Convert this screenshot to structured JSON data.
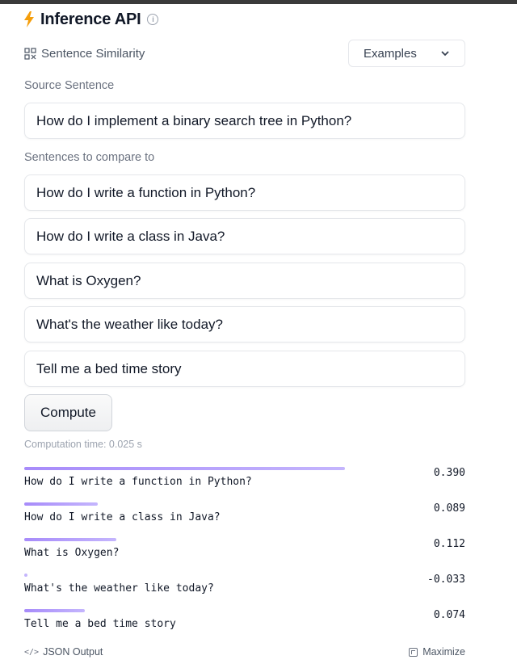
{
  "header": {
    "title": "Inference API",
    "info_icon": "info-icon",
    "bolt_color": "#f59e0b"
  },
  "task": {
    "label": "Sentence Similarity",
    "icon": "grid-icon"
  },
  "examples": {
    "label": "Examples"
  },
  "source": {
    "label": "Source Sentence",
    "value": "How do I implement a binary search tree in Python?"
  },
  "compare": {
    "label": "Sentences to compare to",
    "sentences": [
      "How do I write a function in Python?",
      "How do I write a class in Java?",
      "What is Oxygen?",
      "What's the weather like today?",
      "Tell me a bed time story"
    ]
  },
  "compute": {
    "label": "Compute"
  },
  "computation_time": "Computation time: 0.025 s",
  "results": [
    {
      "text": "How do I write a function in Python?",
      "score": 0.39,
      "score_text": "0.390"
    },
    {
      "text": "How do I write a class in Java?",
      "score": 0.089,
      "score_text": "0.089"
    },
    {
      "text": "What is Oxygen?",
      "score": 0.112,
      "score_text": "0.112"
    },
    {
      "text": "What's the weather like today?",
      "score": -0.033,
      "score_text": "-0.033"
    },
    {
      "text": "Tell me a bed time story",
      "score": 0.074,
      "score_text": "0.074"
    }
  ],
  "footer": {
    "json_label": "JSON Output",
    "maximize_label": "Maximize"
  },
  "colors": {
    "accent": "#a78bfa",
    "bar_light": "#c4b5fd"
  }
}
